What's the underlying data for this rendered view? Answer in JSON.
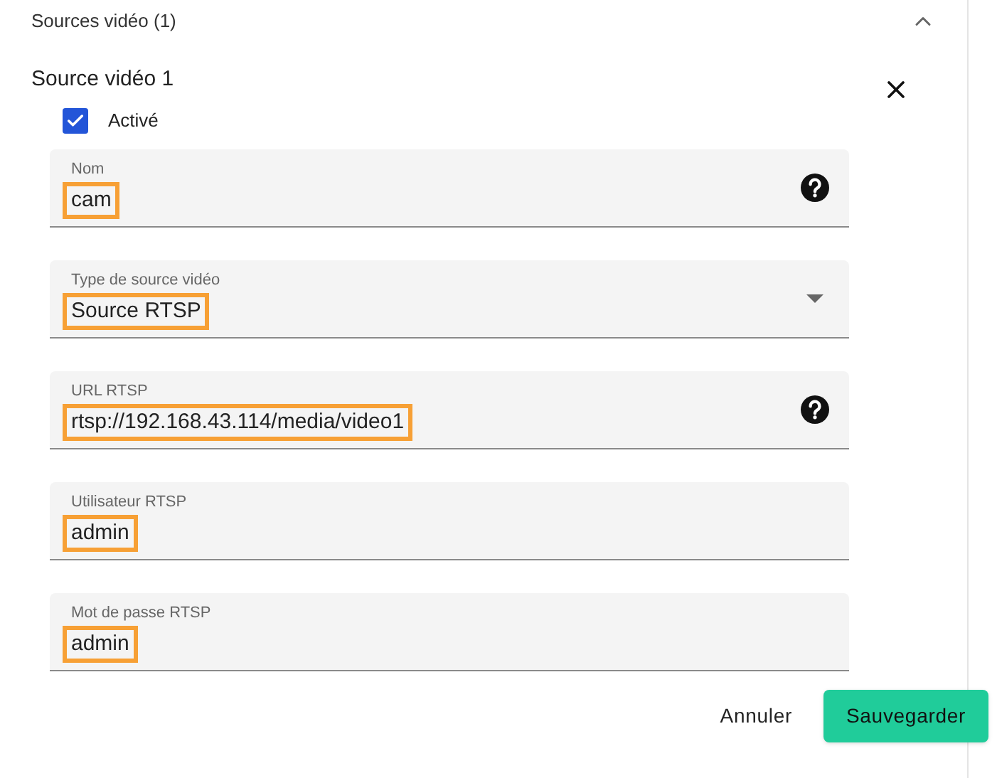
{
  "section": {
    "title": "Sources vidéo (1)",
    "expanded": true
  },
  "source": {
    "title": "Source vidéo 1",
    "enabled": {
      "label": "Activé",
      "checked": true
    }
  },
  "fields": [
    {
      "kind": "text",
      "label": "Nom",
      "value": "cam",
      "help": true,
      "highlighted": true
    },
    {
      "kind": "select",
      "label": "Type de source vidéo",
      "value": "Source RTSP",
      "help": false,
      "highlighted": true
    },
    {
      "kind": "text",
      "label": "URL RTSP",
      "value": "rtsp://192.168.43.114/media/video1",
      "help": true,
      "highlighted": true
    },
    {
      "kind": "text",
      "label": "Utilisateur RTSP",
      "value": "admin",
      "help": false,
      "highlighted": true
    },
    {
      "kind": "text",
      "label": "Mot de passe RTSP",
      "value": "admin",
      "help": false,
      "highlighted": true
    }
  ],
  "buttons": [
    {
      "kind": "text",
      "label": "Annuler"
    },
    {
      "kind": "primary",
      "label": "Sauvegarder"
    }
  ]
}
